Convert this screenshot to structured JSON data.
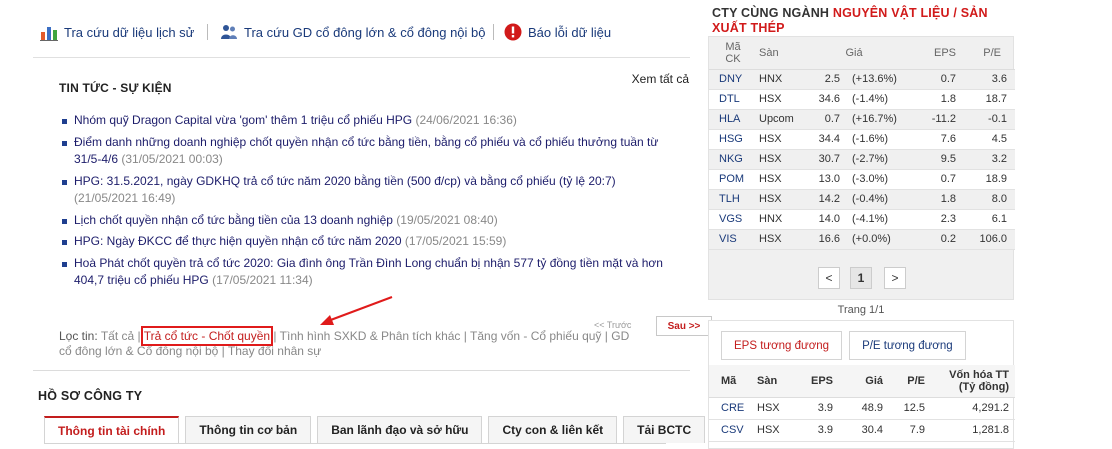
{
  "toplinks": [
    {
      "label": "Tra cứu dữ liệu lịch sử",
      "icon": "bar-chart-icon"
    },
    {
      "label": "Tra cứu GD cổ đông lớn & cổ đông nội bộ",
      "icon": "users-icon"
    },
    {
      "label": "Báo lỗi dữ liệu",
      "icon": "error-icon"
    }
  ],
  "news": {
    "title": "TIN TỨC - SỰ KIỆN",
    "see_all": "Xem tất cả",
    "items": [
      {
        "title": "Nhóm quỹ Dragon Capital vừa 'gom' thêm 1 triệu cổ phiếu HPG",
        "date": "(24/06/2021 16:36)"
      },
      {
        "title": "Điểm danh những doanh nghiệp chốt quyền nhận cổ tức bằng tiền, bằng cổ phiếu và cổ phiếu thưởng tuần từ 31/5-4/6",
        "date": "(31/05/2021 00:03)"
      },
      {
        "title": "HPG: 31.5.2021, ngày GDKHQ trả cổ tức năm 2020 bằng tiền (500 đ/cp) và bằng cổ phiếu (tỷ lệ 20:7)",
        "date": "(21/05/2021 16:49)"
      },
      {
        "title": "Lịch chốt quyền nhận cổ tức bằng tiền của 13 doanh nghiệp",
        "date": "(19/05/2021 08:40)"
      },
      {
        "title": "HPG: Ngày ĐKCC để thực hiện quyền nhận cổ tức năm 2020",
        "date": "(17/05/2021 15:59)"
      },
      {
        "title": "Hoà Phát chốt quyền trả cổ tức 2020: Gia đình ông Trần Đình Long chuẩn bị nhận 577 tỷ đồng tiền mặt và hơn 404,7 triệu cổ phiếu HPG",
        "date": "(17/05/2021 11:34)"
      }
    ],
    "prev": "<< Trước",
    "next": "Sau >>",
    "filter_label": "Lọc tin:",
    "filters": [
      "Tất cả",
      "Trả cổ tức - Chốt quyền",
      "Tình hình SXKD & Phân tích khác",
      "Tăng vốn - Cổ phiếu quỹ",
      "GD cổ đông lớn & Cổ đông nội bộ",
      "Thay đổi nhân sự"
    ]
  },
  "profile": {
    "title": "HỒ SƠ CÔNG TY",
    "tabs": [
      "Thông tin tài chính",
      "Thông tin cơ bản",
      "Ban lãnh đạo và sở hữu",
      "Cty con & liên kết",
      "Tải BCTC"
    ]
  },
  "industry": {
    "heading_prefix": "CTY CÙNG NGÀNH",
    "heading_name": "NGUYÊN VẬT LIỆU / SẢN XUẤT THÉP",
    "headers": [
      "Mã CK",
      "Sàn",
      "Giá",
      "EPS",
      "P/E"
    ],
    "rows": [
      {
        "ma": "DNY",
        "san": "HNX",
        "gia": "2.5",
        "pct": "(+13.6%)",
        "dir": "up",
        "eps": "0.7",
        "pe": "3.6"
      },
      {
        "ma": "DTL",
        "san": "HSX",
        "gia": "34.6",
        "pct": "(-1.4%)",
        "dir": "down",
        "eps": "1.8",
        "pe": "18.7"
      },
      {
        "ma": "HLA",
        "san": "Upcom",
        "gia": "0.7",
        "pct": "(+16.7%)",
        "dir": "up",
        "eps": "-11.2",
        "pe": "-0.1"
      },
      {
        "ma": "HSG",
        "san": "HSX",
        "gia": "34.4",
        "pct": "(-1.6%)",
        "dir": "down",
        "eps": "7.6",
        "pe": "4.5"
      },
      {
        "ma": "NKG",
        "san": "HSX",
        "gia": "30.7",
        "pct": "(-2.7%)",
        "dir": "down",
        "eps": "9.5",
        "pe": "3.2"
      },
      {
        "ma": "POM",
        "san": "HSX",
        "gia": "13.0",
        "pct": "(-3.0%)",
        "dir": "down",
        "eps": "0.7",
        "pe": "18.9"
      },
      {
        "ma": "TLH",
        "san": "HSX",
        "gia": "14.2",
        "pct": "(-0.4%)",
        "dir": "down",
        "eps": "1.8",
        "pe": "8.0"
      },
      {
        "ma": "VGS",
        "san": "HNX",
        "gia": "14.0",
        "pct": "(-4.1%)",
        "dir": "down",
        "eps": "2.3",
        "pe": "6.1"
      },
      {
        "ma": "VIS",
        "san": "HSX",
        "gia": "16.6",
        "pct": "(+0.0%)",
        "dir": "ref",
        "eps": "0.2",
        "pe": "106.0"
      }
    ],
    "pager": {
      "prev": "<",
      "current": "1",
      "next": ">",
      "info": "Trang 1/1"
    },
    "colors": {
      "up": "#d400d4",
      "down": "#d11a1a",
      "ref": "#e8a000"
    }
  },
  "equiv": {
    "tabs": [
      "EPS tương đương",
      "P/E tương đương"
    ],
    "headers": [
      "Mã",
      "Sàn",
      "EPS",
      "Giá",
      "P/E",
      "Vốn hóa TT (Tỷ đồng)"
    ],
    "rows": [
      {
        "ma": "CRE",
        "san": "HSX",
        "eps": "3.9",
        "gia": "48.9",
        "pe": "12.5",
        "von": "4,291.2"
      },
      {
        "ma": "CSV",
        "san": "HSX",
        "eps": "3.9",
        "gia": "30.4",
        "pe": "7.9",
        "von": "1,281.8"
      }
    ]
  }
}
